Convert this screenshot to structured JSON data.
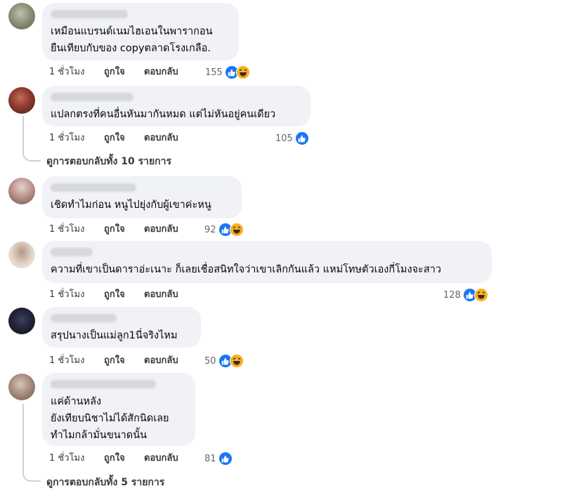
{
  "comments": [
    {
      "text": "เหมือนแบรนด์เนมไฮเอนในพารากอน\nยืนเทียบกับของ copyตลาดโรงเกลือ.",
      "time": "1 ชั่วโมง",
      "like": "ถูกใจ",
      "reply": "ตอบกลับ",
      "reactions": "155",
      "reaction_icons": [
        "like-icon",
        "haha-icon"
      ]
    },
    {
      "text": "แปลกตรงที่คนอื่นหันมากันหมด แต่ไม่หันอยู่คนเดียว",
      "time": "1 ชั่วโมง",
      "like": "ถูกใจ",
      "reply": "ตอบกลับ",
      "reactions": "105",
      "reaction_icons": [
        "like-icon"
      ],
      "view_replies": "ดูการตอบกลับทั้ง 10 รายการ"
    },
    {
      "text": "เชิดทำไมก่อน หนูไปยุ่งกับผู้เขาค่ะหนู",
      "time": "1 ชั่วโมง",
      "like": "ถูกใจ",
      "reply": "ตอบกลับ",
      "reactions": "92",
      "reaction_icons": [
        "like-icon",
        "haha-icon"
      ]
    },
    {
      "text": "ความที่เขาเป็นดาราอ่ะเนาะ ก็เลยเชื่อสนิทใจว่าเขาเลิกกันแล้ว แหม่โทษตัวเองกี่โมงจะสาว",
      "time": "1 ชั่วโมง",
      "like": "ถูกใจ",
      "reply": "ตอบกลับ",
      "reactions": "128",
      "reaction_icons": [
        "like-icon",
        "haha-icon"
      ]
    },
    {
      "text": "สรุปนางเป็นแม่ลูก1นี่จริงไหม",
      "time": "1 ชั่วโมง",
      "like": "ถูกใจ",
      "reply": "ตอบกลับ",
      "reactions": "50",
      "reaction_icons": [
        "like-icon",
        "haha-icon"
      ]
    },
    {
      "text": "แค่ด้านหลัง\nยังเทียบนิชาไม่ได้สักนิดเลย\nทำไมกล้ามั่นขนาดนั้น",
      "time": "1 ชั่วโมง",
      "like": "ถูกใจ",
      "reply": "ตอบกลับ",
      "reactions": "81",
      "reaction_icons": [
        "like-icon"
      ],
      "view_replies": "ดูการตอบกลับทั้ง 5 รายการ"
    }
  ],
  "colors": {
    "bubble": "#f0f2f5",
    "like_blue": "#1877f2",
    "haha_yellow": "#f7b125",
    "muted_text": "#65676b"
  }
}
